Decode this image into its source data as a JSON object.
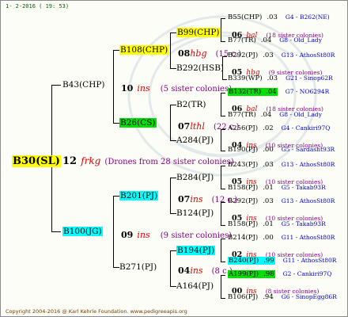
{
  "header": {
    "date": "1- 2-2016 ( 19: 53)"
  },
  "footer": {
    "copyright": "Copyright 2004-2016 @ Karl Kehrle Foundation.   www.pedigreeapis.org"
  },
  "root": {
    "name": "B30(SL)",
    "num": "12",
    "ins": "frkg",
    "note": "(Drones from 28 sister colonies)"
  },
  "gen1": [
    {
      "name": "B43(CHP)",
      "num": "10",
      "ins": "ins",
      "note": "(5 sister colonies)"
    },
    {
      "name": "B100(JG)",
      "num": "09",
      "ins": "ins",
      "note": "(9 sister colonies)"
    }
  ],
  "gen2": [
    {
      "name": "B108(CHP)",
      "num": "08",
      "ins": "hbg",
      "note": "(15 c.)"
    },
    {
      "name": "B26(CS)",
      "num": "07",
      "ins": "lthl",
      "note": "(22 c.)"
    },
    {
      "name": "B201(PJ)",
      "num": "07",
      "ins": "ins",
      "note": "(12 c.)"
    },
    {
      "name": "B271(PJ)",
      "num": "04",
      "ins": "ins",
      "note": "(8 c.)"
    }
  ],
  "gen3": [
    {
      "name": "B99(CHP)",
      "num": "06",
      "ins": "bal",
      "note": "(18 sister colonies)"
    },
    {
      "name": "B292(HSB)",
      "num": "05",
      "ins": "hbg",
      "note": "(9 sister colonies)"
    },
    {
      "name": "B2(TR)",
      "num": "06",
      "ins": "bal",
      "note": "(18 sister colonies)"
    },
    {
      "name": "A284(PJ)",
      "num": "04",
      "ins": "ins",
      "note": "(10 sister colonies)"
    },
    {
      "name": "B284(PJ)",
      "num": "05",
      "ins": "ins",
      "note": "(10 sister colonies)"
    },
    {
      "name": "B124(PJ)",
      "num": "05",
      "ins": "ins",
      "note": "(10 sister colonies)"
    },
    {
      "name": "B194(PJ)",
      "num": "02",
      "ins": "ins",
      "note": "(10 sister colonies)"
    },
    {
      "name": "A164(PJ)",
      "num": "00",
      "ins": "ins",
      "note": "(8 sister colonies)"
    }
  ],
  "gen4": [
    {
      "name": "B55(CHP)",
      "val": ".03",
      "code": "G4 - B262(NE)"
    },
    {
      "name": "B77(TR)",
      "val": ".04",
      "code": "G8 - Old_Lady"
    },
    {
      "name": "B292(PJ)",
      "val": ".03",
      "code": "G13 - AthosSt80R"
    },
    {
      "name": "B339(WP)",
      "val": ".03",
      "code": "G21 - Sinop62R"
    },
    {
      "name": "B132(TR)",
      "val": ".04",
      "code": "G7 - NO6294R"
    },
    {
      "name": "B77(TR)",
      "val": ".04",
      "code": "G8 - Old_Lady"
    },
    {
      "name": "A256(PJ)",
      "val": ".02",
      "code": "G4 - Cankiri97Q"
    },
    {
      "name": "B190(PJ)",
      "val": ".00",
      "code": "G5 - Sardasht93R"
    },
    {
      "name": "B243(PJ)",
      "val": ".03",
      "code": "G13 - AthosSt80R"
    },
    {
      "name": "B158(PJ)",
      "val": ".01",
      "code": "G5 - Takab93R"
    },
    {
      "name": "B292(PJ)",
      "val": ".03",
      "code": "G13 - AthosSt80R"
    },
    {
      "name": "B158(PJ)",
      "val": ".01",
      "code": "G5 - Takab93R"
    },
    {
      "name": "B214(PJ)",
      "val": ".00",
      "code": "G11 - AthosSt80R"
    },
    {
      "name": "B240(PJ)",
      "val": ".99",
      "code": "G11 - AthosSt80R"
    },
    {
      "name": "A199(PJ)",
      "val": ".98",
      "code": "G2 - Cankiri97Q"
    },
    {
      "name": "B106(PJ)",
      "val": ".94",
      "code": "G6 - SinopEgg86R"
    }
  ]
}
